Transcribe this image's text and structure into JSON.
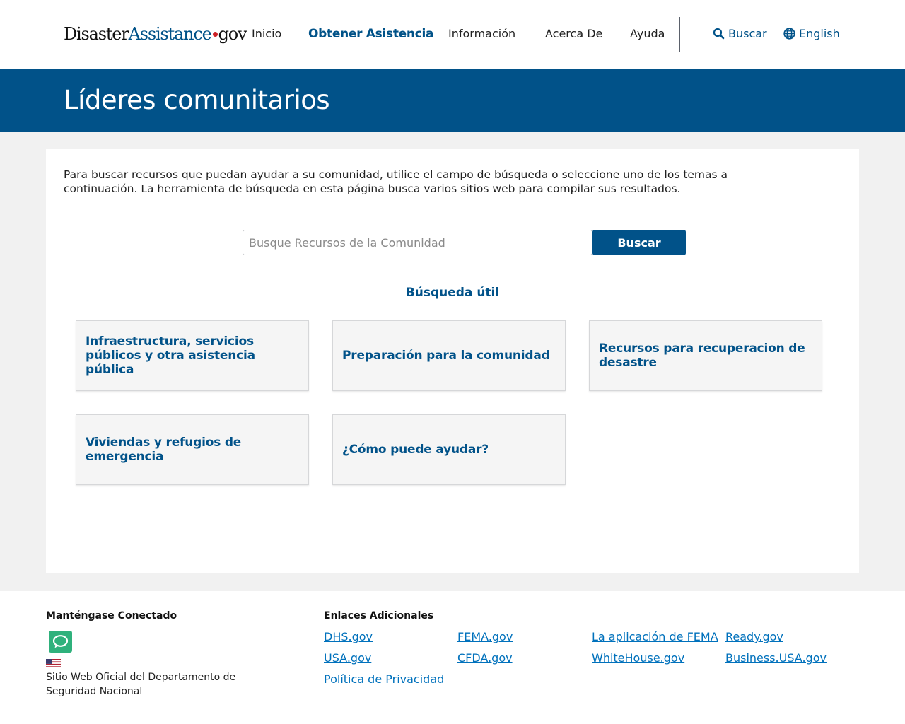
{
  "header": {
    "logo": {
      "part1": "Disaster",
      "part2": "Assistance",
      "part3": "gov"
    },
    "nav": [
      {
        "label": "Inicio",
        "active": false
      },
      {
        "label": "Obtener Asistencia",
        "active": true
      },
      {
        "label": "Información",
        "active": false
      },
      {
        "label": "Acerca De",
        "active": false
      },
      {
        "label": "Ayuda",
        "active": false
      }
    ],
    "search_label": "Buscar",
    "language_label": "English",
    "search_icon": "search-icon",
    "language_icon": "globe-icon"
  },
  "hero": {
    "title": "Líderes comunitarios"
  },
  "main": {
    "intro": "Para buscar recursos que puedan ayudar a su comunidad, utilice el campo de búsqueda o seleccione uno de los temas a continuación. La herramienta de búsqueda en esta página busca varios sitios web para compilar sus resultados.",
    "search_placeholder": "Busque Recursos de la Comunidad",
    "search_value": "",
    "search_button": "Buscar",
    "helpful_heading": "Búsqueda útil",
    "topics": [
      {
        "label": "Infraestructura, servicios públicos y otra asistencia pública"
      },
      {
        "label": "Preparación para la comunidad"
      },
      {
        "label": "Recursos para recuperacion de desastre"
      },
      {
        "label": "Viviendas y refugios de emergencia"
      },
      {
        "label": "¿Cómo puede ayudar?"
      }
    ]
  },
  "footer": {
    "connected_heading": "Manténgase Conectado",
    "chat_icon": "chat-bubble-icon",
    "flag_icon": "us-flag-icon",
    "dhs_text": "Sitio Web Oficial del Departamento de Seguridad Nacional",
    "links_heading": "Enlaces Adicionales",
    "links": [
      {
        "label": "DHS.gov"
      },
      {
        "label": "FEMA.gov"
      },
      {
        "label": "La aplicación de FEMA"
      },
      {
        "label": "Ready.gov"
      },
      {
        "label": "USA.gov"
      },
      {
        "label": "CFDA.gov"
      },
      {
        "label": "WhiteHouse.gov"
      },
      {
        "label": "Business.USA.gov"
      },
      {
        "label": "Política de Privacidad"
      }
    ]
  },
  "colors": {
    "primary_blue": "#015289",
    "link_blue": "#0071bc",
    "logo_dot_red": "#cd2026",
    "chat_green": "#2fb17c",
    "background_gray": "#f1f1f1"
  }
}
